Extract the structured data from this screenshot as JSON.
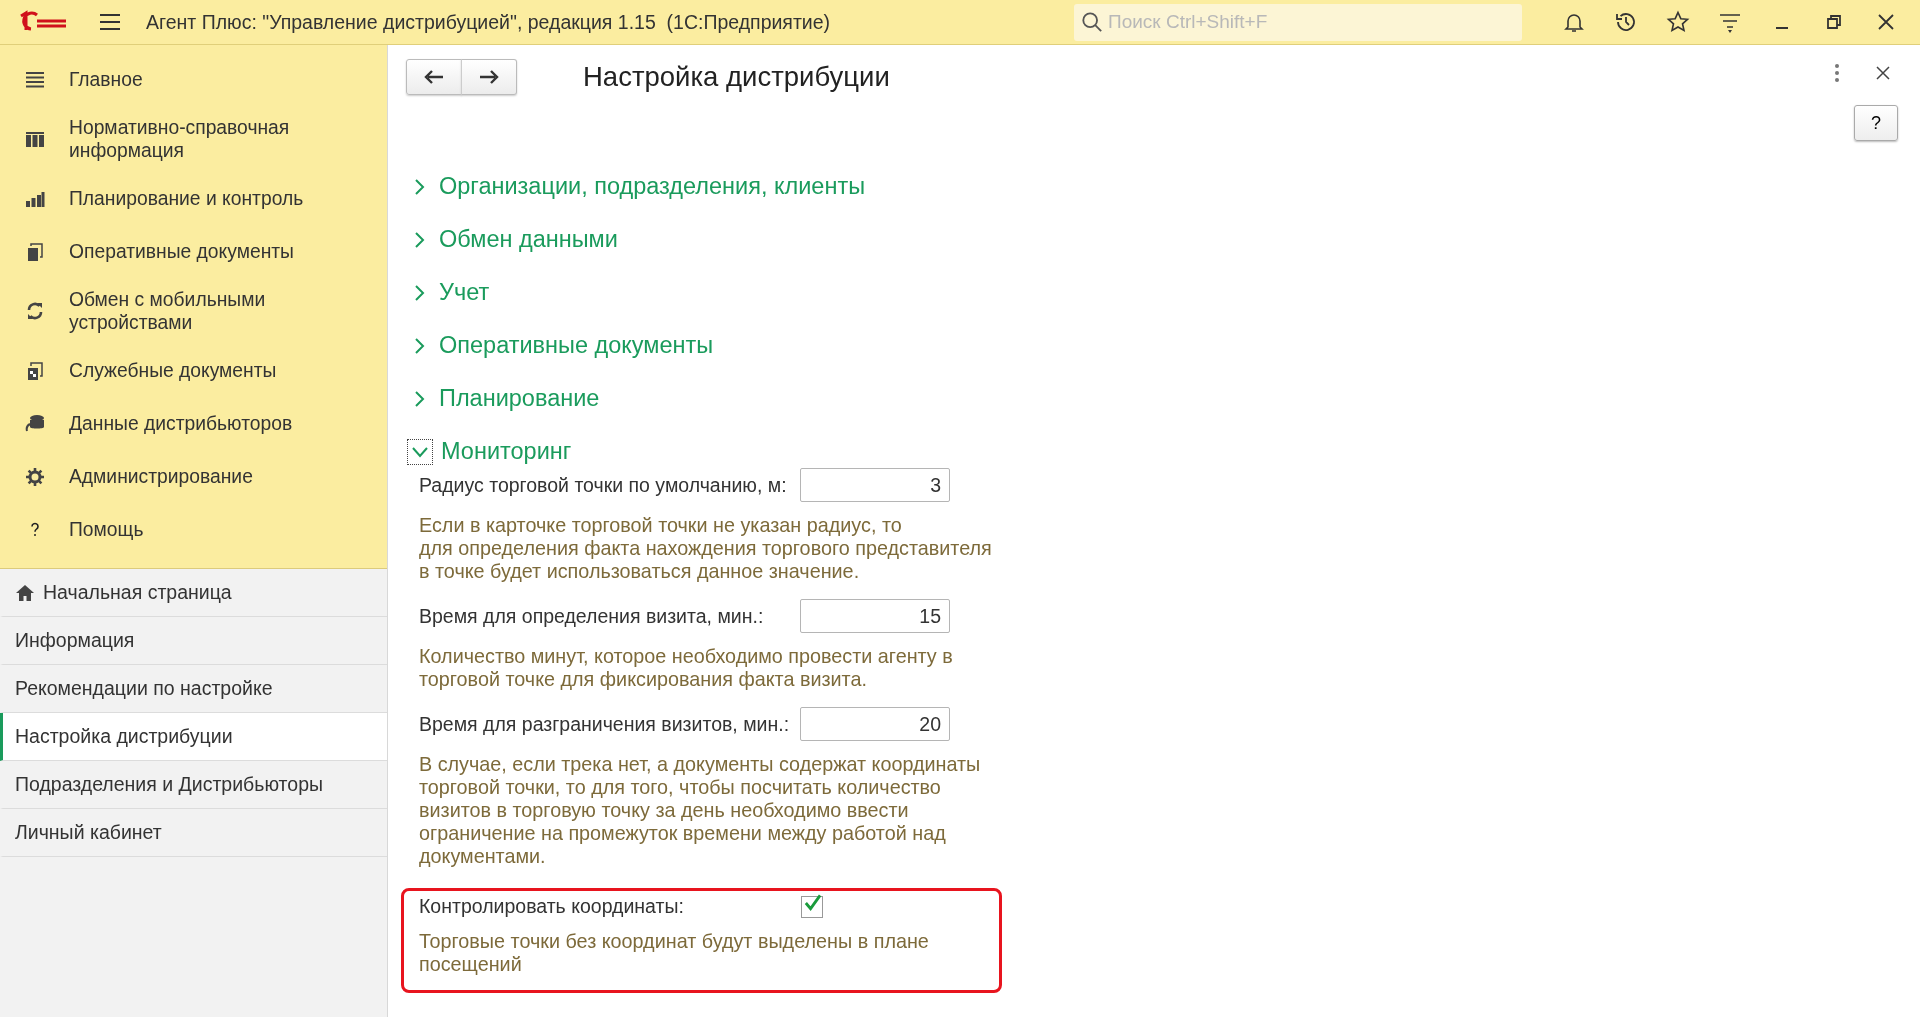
{
  "window": {
    "title": "Агент Плюс: \"Управление дистрибуцией\", редакция 1.15  (1С:Предприятие)",
    "search_placeholder": "Поиск Ctrl+Shift+F"
  },
  "sidebar": {
    "sections": [
      {
        "label": "Главное"
      },
      {
        "label": "Нормативно-справочная информация"
      },
      {
        "label": "Планирование и контроль"
      },
      {
        "label": "Оперативные документы"
      },
      {
        "label": "Обмен с мобильными устройствами"
      },
      {
        "label": "Служебные документы"
      },
      {
        "label": "Данные дистрибьюторов"
      },
      {
        "label": "Администрирование"
      },
      {
        "label": "Помощь"
      }
    ],
    "pages": [
      {
        "label": "Начальная страница",
        "selected": false
      },
      {
        "label": "Информация",
        "selected": false
      },
      {
        "label": "Рекомендации по настройке",
        "selected": false
      },
      {
        "label": "Настройка дистрибуции",
        "selected": true
      },
      {
        "label": "Подразделения и Дистрибьюторы",
        "selected": false
      },
      {
        "label": "Личный кабинет",
        "selected": false
      }
    ]
  },
  "form": {
    "title": "Настройка дистрибуции",
    "help_button": "?",
    "groups": [
      {
        "label": "Организации, подразделения, клиенты",
        "expanded": false
      },
      {
        "label": "Обмен данными",
        "expanded": false
      },
      {
        "label": "Учет",
        "expanded": false
      },
      {
        "label": "Оперативные документы",
        "expanded": false
      },
      {
        "label": "Планирование",
        "expanded": false
      },
      {
        "label": "Мониторинг",
        "expanded": true,
        "fields": [
          {
            "kind": "number",
            "label": "Радиус торговой точки по умолчанию, м:",
            "value": "3",
            "hint": "Если в карточке торговой точки не указан радиус, то\nдля определения факта нахождения торгового представителя в точке будет использоваться данное значение.",
            "highlighted": false
          },
          {
            "kind": "number",
            "label": "Время для определения визита, мин.:",
            "value": "15",
            "hint": "Количество минут, которое необходимо провести агенту в торговой точке для фиксирования факта визита.",
            "highlighted": false
          },
          {
            "kind": "number",
            "label": "Время для разграничения визитов, мин.:",
            "value": "20",
            "hint": "В случае, если трека нет, а документы содержат координаты торговой точки, то для того, чтобы посчитать количество визитов в торговую точку за день необходимо ввести ограничение на промежуток времени между работой над документами.",
            "highlighted": false
          },
          {
            "kind": "checkbox",
            "label": "Контролировать координаты:",
            "checked": true,
            "hint": "Торговые точки без координат будут выделены в плане посещений",
            "highlighted": true
          }
        ]
      }
    ]
  }
}
